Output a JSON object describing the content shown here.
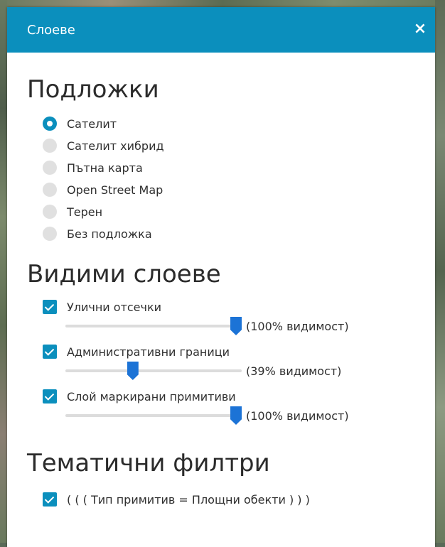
{
  "dialog": {
    "title": "Слоеве",
    "close_icon": "×"
  },
  "basemaps": {
    "heading": "Подложки",
    "selected": 0,
    "options": [
      {
        "label": "Сателит",
        "checked": true
      },
      {
        "label": "Сателит хибрид",
        "checked": false
      },
      {
        "label": "Пътна карта",
        "checked": false
      },
      {
        "label": "Open Street Map",
        "checked": false
      },
      {
        "label": "Терен",
        "checked": false
      },
      {
        "label": "Без подложка",
        "checked": false
      }
    ]
  },
  "visible_layers": {
    "heading": "Видими слоеве",
    "layers": [
      {
        "label": "Улични отсечки",
        "checked": true,
        "opacity_percent": 100,
        "opacity_text": "(100% видимост)"
      },
      {
        "label": "Административни граници",
        "checked": true,
        "opacity_percent": 39,
        "opacity_text": "(39% видимост)"
      },
      {
        "label": "Слой маркирани примитиви",
        "checked": true,
        "opacity_percent": 100,
        "opacity_text": "(100% видимост)"
      }
    ]
  },
  "thematic_filters": {
    "heading": "Тематични филтри",
    "filters": [
      {
        "label": "( ( ( Тип примитив = Площни обекти ) ) )",
        "checked": true
      }
    ]
  },
  "colors": {
    "accent": "#0b8fbd",
    "slider_handle": "#1c73d6"
  }
}
